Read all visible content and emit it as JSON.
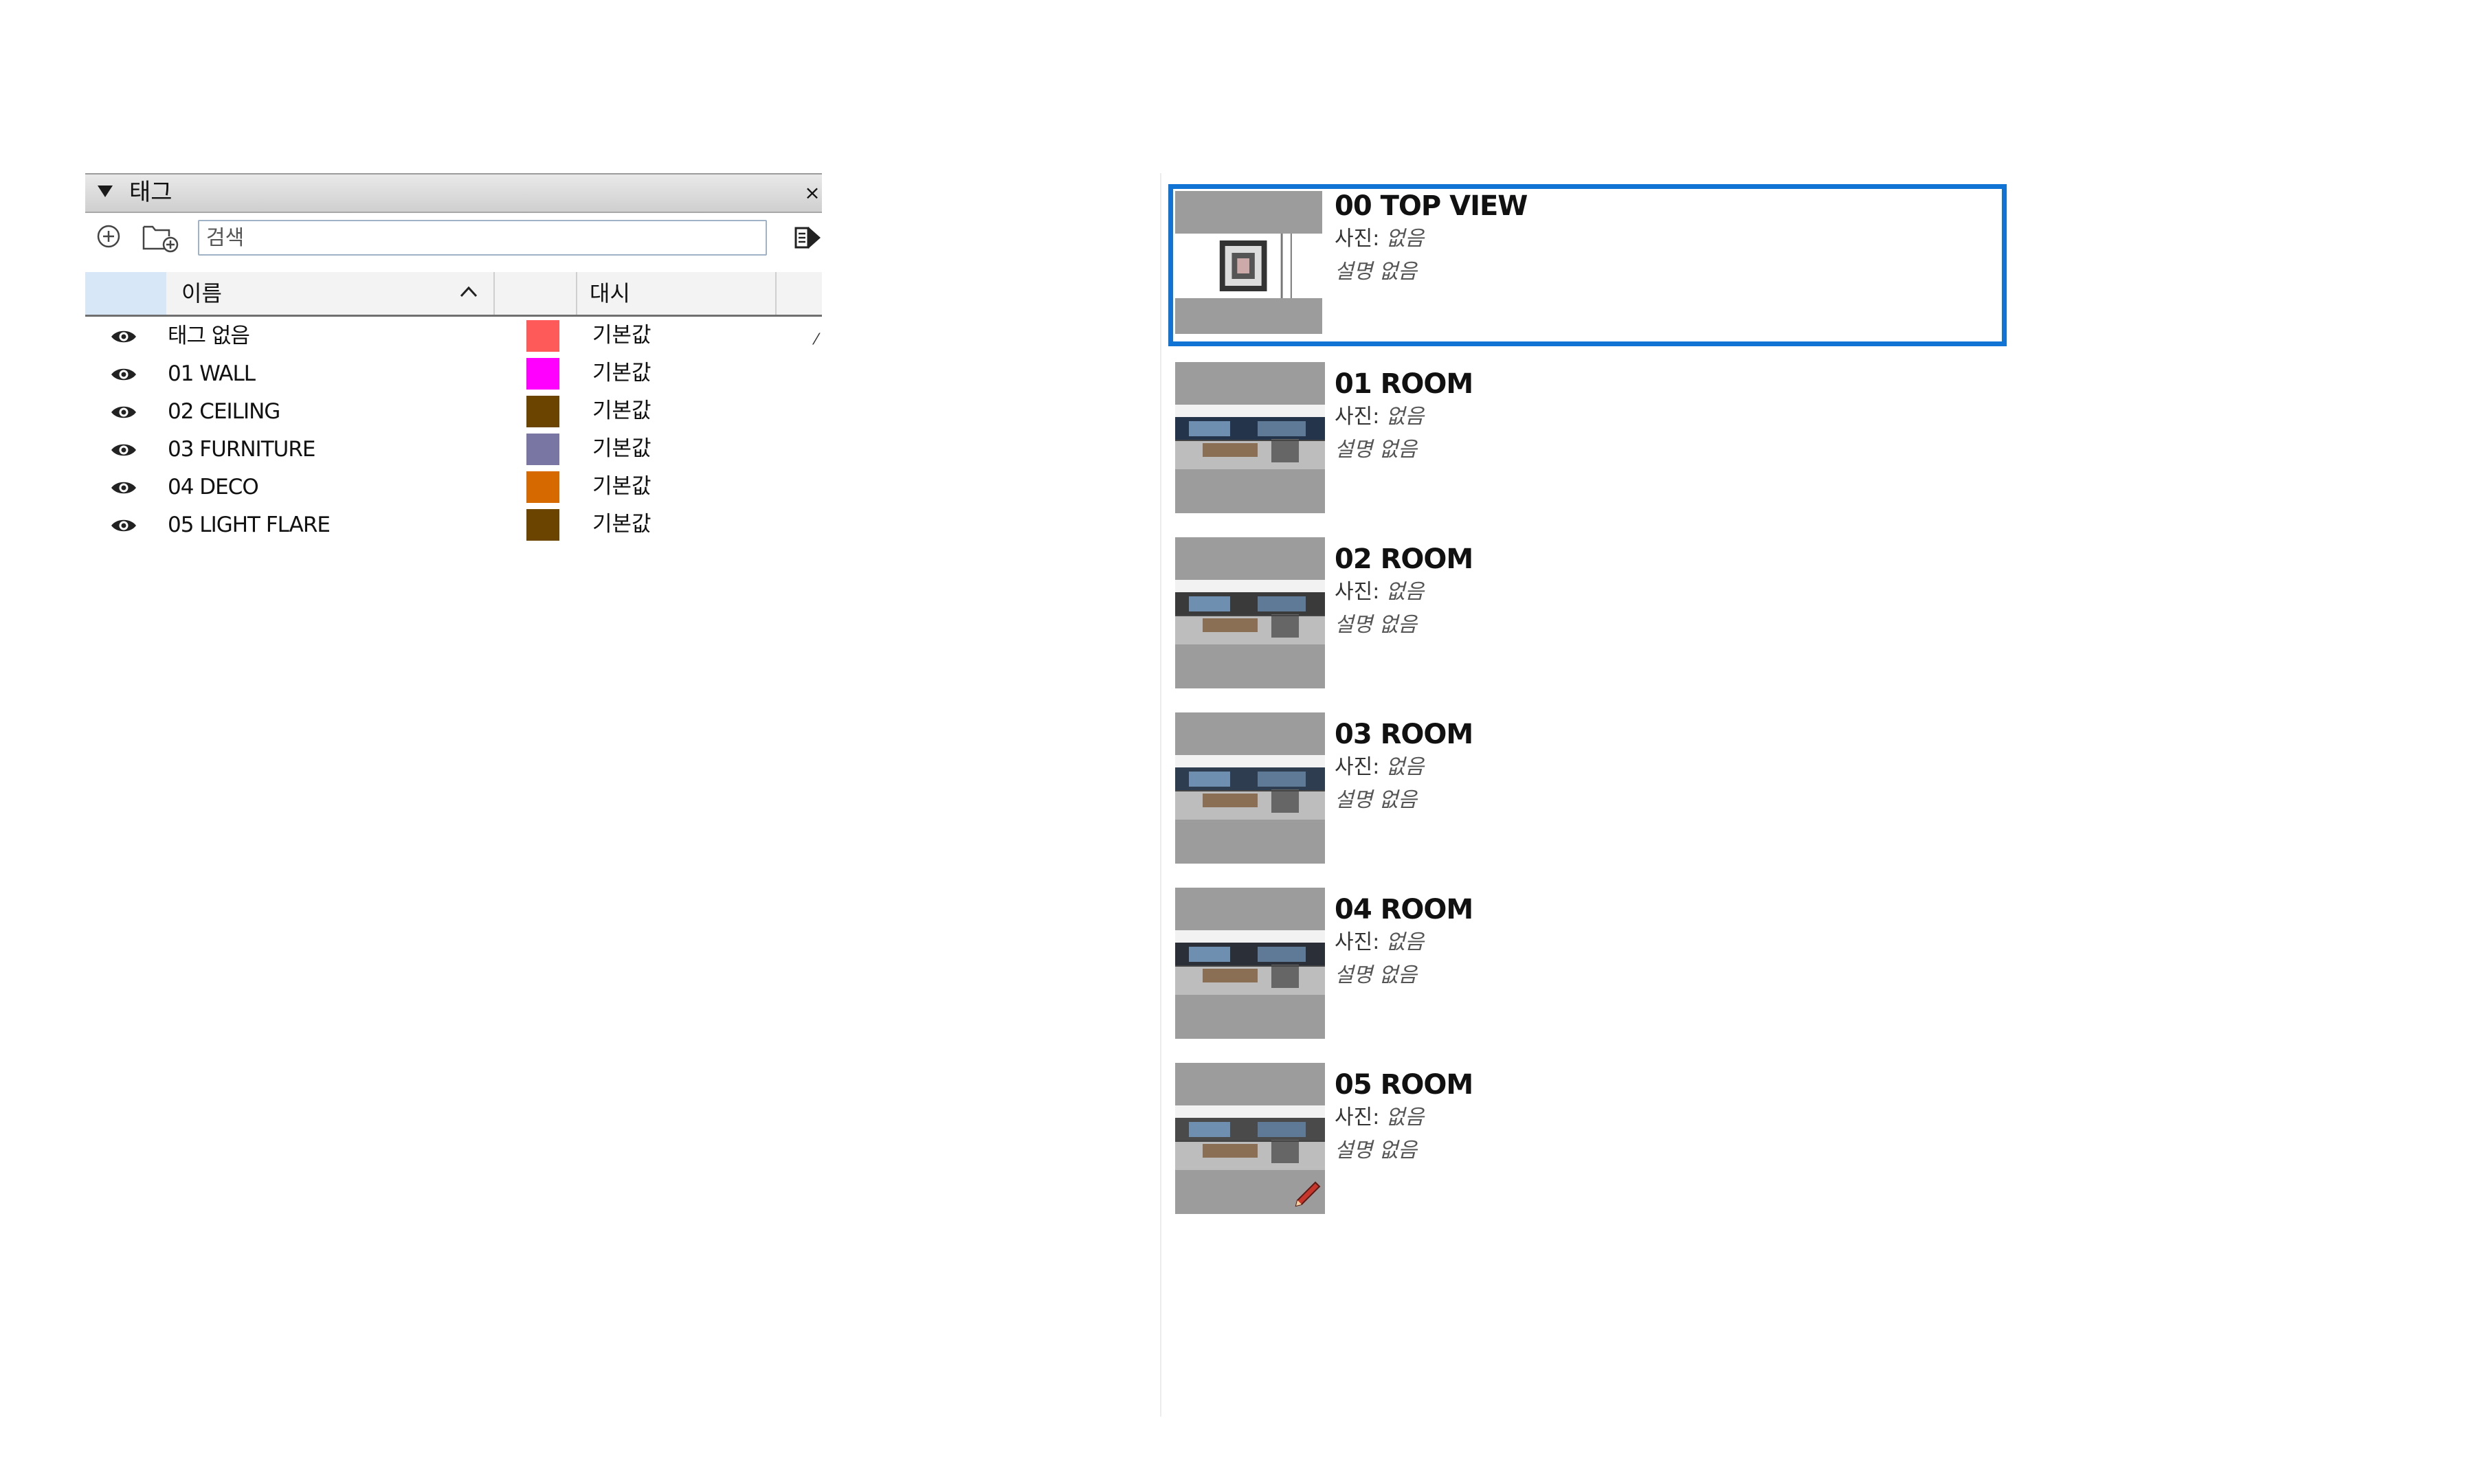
{
  "tags_panel": {
    "title": "태그",
    "close_label": "×",
    "search": {
      "placeholder": "검색",
      "value": ""
    },
    "columns": {
      "name": "이름",
      "dash": "대시"
    },
    "rows": [
      {
        "name": "태그 없음",
        "color": "#ff5a5a",
        "dash": "기본값",
        "visible": true
      },
      {
        "name": "01 WALL",
        "color": "#ff00ff",
        "dash": "기본값",
        "visible": true
      },
      {
        "name": "02 CEILING",
        "color": "#6b4400",
        "dash": "기본값",
        "visible": true
      },
      {
        "name": "03 FURNITURE",
        "color": "#7976a3",
        "dash": "기본값",
        "visible": true
      },
      {
        "name": "04 DECO",
        "color": "#d66a00",
        "dash": "기본값",
        "visible": true
      },
      {
        "name": "05 LIGHT FLARE",
        "color": "#6b4400",
        "dash": "기본값",
        "visible": true
      }
    ]
  },
  "scenes_panel": {
    "selected_color": "#1173d4",
    "photo_label": "사진:",
    "items": [
      {
        "title": "00 TOP VIEW",
        "photo_value": "없음",
        "description": "설명 없음",
        "selected": true
      },
      {
        "title": "01 ROOM",
        "photo_value": "없음",
        "description": "설명 없음",
        "selected": false
      },
      {
        "title": "02 ROOM",
        "photo_value": "없음",
        "description": "설명 없음",
        "selected": false
      },
      {
        "title": "03 ROOM",
        "photo_value": "없음",
        "description": "설명 없음",
        "selected": false
      },
      {
        "title": "04 ROOM",
        "photo_value": "없음",
        "description": "설명 없음",
        "selected": false
      },
      {
        "title": "05 ROOM",
        "photo_value": "없음",
        "description": "설명 없음",
        "selected": false,
        "edit_icon": "pencil-icon"
      }
    ]
  }
}
